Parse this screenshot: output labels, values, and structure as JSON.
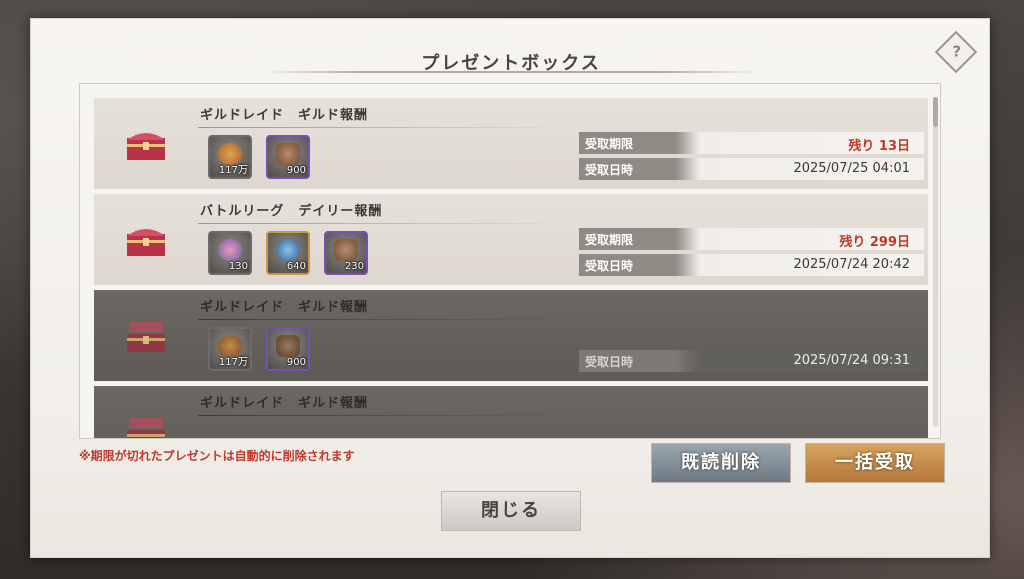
{
  "dialog": {
    "title": "プレゼントボックス",
    "help_label": "?"
  },
  "rows": [
    {
      "title": "ギルドレイド　ギルド報酬",
      "state": "unread",
      "items": [
        {
          "icon": "coin-icon",
          "quantity": "117万",
          "rarity": "normal"
        },
        {
          "icon": "ore-icon",
          "quantity": "900",
          "rarity": "purple"
        }
      ],
      "deadline_label": "受取期限",
      "deadline_value": "残り 13日",
      "date_label": "受取日時",
      "date_value": "2025/07/25 04:01"
    },
    {
      "title": "バトルリーグ　デイリー報酬",
      "state": "unread",
      "items": [
        {
          "icon": "crystal-icon",
          "quantity": "130",
          "rarity": "normal"
        },
        {
          "icon": "medal-icon",
          "quantity": "640",
          "rarity": "gold"
        },
        {
          "icon": "ore-icon",
          "quantity": "230",
          "rarity": "purple"
        }
      ],
      "deadline_label": "受取期限",
      "deadline_value": "残り 299日",
      "date_label": "受取日時",
      "date_value": "2025/07/24 20:42"
    },
    {
      "title": "ギルドレイド　ギルド報酬",
      "state": "read",
      "items": [
        {
          "icon": "coin-icon",
          "quantity": "117万",
          "rarity": "normal"
        },
        {
          "icon": "ore-icon",
          "quantity": "900",
          "rarity": "purple"
        }
      ],
      "date_label": "受取日時",
      "date_value": "2025/07/24 09:31"
    },
    {
      "title": "ギルドレイド　ギルド報酬",
      "state": "read"
    }
  ],
  "footer": {
    "note": "※期限が切れたプレゼントは自動的に削除されます",
    "delete_read_label": "既読削除",
    "claim_all_label": "一括受取",
    "close_label": "閉じる"
  },
  "colors": {
    "unread_row": "#e2ddd5",
    "read_row": "#65625e",
    "deadline_red": "#c0392b",
    "rarity_purple": "#7a4fb5",
    "rarity_gold": "#c99b3d"
  }
}
